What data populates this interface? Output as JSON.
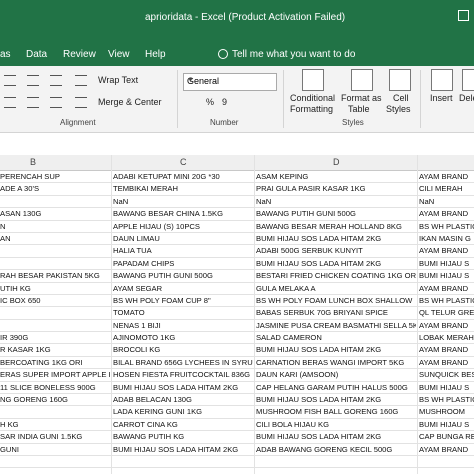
{
  "window": {
    "title": "aprioridata  -  Excel (Product Activation Failed)"
  },
  "menu": {
    "items": [
      "as",
      "Data",
      "Review",
      "View",
      "Help"
    ],
    "tell_me": "Tell me what you want to do"
  },
  "ribbon": {
    "wrap_text": "Wrap Text",
    "merge_center": "Merge & Center",
    "number_format": "General",
    "conditional_formatting": [
      "Conditional",
      "Formatting"
    ],
    "format_as_table": [
      "Format as",
      "Table"
    ],
    "cell_styles": [
      "Cell",
      "Styles"
    ],
    "insert": "Insert",
    "delete": "Delete",
    "group_alignment": "Alignment",
    "group_number": "Number",
    "group_styles": "Styles",
    "number_symbols": [
      "%",
      "9"
    ]
  },
  "columns": [
    "B",
    "C",
    "D"
  ],
  "rows": [
    [
      "PERENCAH SUP",
      "ADABI KETUPAT MINI 20G *30",
      "ASAM KEPING",
      "AYAM BRAND"
    ],
    [
      "ADE A 30'S",
      "TEMBIKAI MERAH",
      "PRAI GULA PASIR KASAR 1KG",
      "CILI MERAH"
    ],
    [
      "",
      "NaN",
      "NaN",
      "NaN"
    ],
    [
      "ASAN 130G",
      "BAWANG BESAR CHINA 1.5KG",
      "BAWANG PUTIH GUNI 500G",
      "AYAM BRAND"
    ],
    [
      "N",
      "APPLE HIJAU (S) 10PCS",
      "BAWANG BESAR MERAH HOLLAND 8KG",
      "BS WH PLASTIC"
    ],
    [
      "AN",
      "DAUN LIMAU",
      "BUMI HIJAU SOS LADA HITAM 2KG",
      "IKAN MASIN G"
    ],
    [
      "",
      "HALIA TUA",
      "ADABI 500G SERBUK KUNYIT",
      "AYAM BRAND"
    ],
    [
      "",
      "PAPADAM CHIPS",
      "BUMI HIJAU SOS LADA HITAM 2KG",
      "BUMI HIJAU S"
    ],
    [
      "RAH BESAR PAKISTAN 5KG",
      "BAWANG PUTIH GUNI 500G",
      "BESTARI FRIED CHICKEN COATING 1KG ORI",
      "BUMI HIJAU S"
    ],
    [
      "UTIH KG",
      "AYAM SEGAR",
      "GULA MELAKA A",
      "AYAM BRAND"
    ],
    [
      "IC BOX 650",
      "BS WH POLY FOAM CUP 8\"",
      "BS WH POLY FOAM LUNCH BOX SHALLOW",
      "BS WH PLASTIC"
    ],
    [
      "",
      "TOMATO",
      "BABAS SERBUK 70G BRIYANI SPICE",
      "QL TELUR GRE"
    ],
    [
      "",
      "NENAS 1 BIJI",
      "JASMINE PUSA CREAM BASMATHI SELLA 5KG",
      "AYAM BRAND"
    ],
    [
      "IR 390G",
      "AJINOMOTO 1KG",
      "SALAD CAMERON",
      "LOBAK MERAH"
    ],
    [
      "R KASAR 1KG",
      "BROCOLI KG",
      "BUMI HIJAU SOS LADA HITAM 2KG",
      "AYAM BRAND"
    ],
    [
      "BERCOATING 1KG ORI",
      "BILAL BRAND 656G LYCHEES IN SYRUP",
      "CARNATION BERAS WANGI IMPORT 5KG",
      "AYAM BRAND"
    ],
    [
      "ERAS SUPER IMPORT APPLE H",
      "HOSEN FIESTA FRUITCOCKTAIL 836G",
      "DAUN KARI (AMSOON)",
      "SUNQUICK BES"
    ],
    [
      "11 SLICE BONELESS 900G",
      "BUMI HIJAU SOS LADA HITAM 2KG",
      "CAP HELANG GARAM PUTIH HALUS 500G",
      "BUMI HIJAU S"
    ],
    [
      "NG GORENG 160G",
      "ADAB BELACAN 130G",
      "BUMI HIJAU SOS LADA HITAM 2KG",
      "BS WH PLASTIC"
    ],
    [
      "",
      "LADA KERING GUNI 1KG",
      "MUSHROOM FISH BALL GORENG 160G",
      "MUSHROOM"
    ],
    [
      "H KG",
      "CARROT CINA KG",
      "CILI BOLA HIJAU KG",
      "BUMI HIJAU S"
    ],
    [
      "SAR INDIA GUNI 1.5KG",
      "BAWANG PUTIH KG",
      "BUMI HIJAU SOS LADA HITAM 2KG",
      "CAP BUNGA RE"
    ],
    [
      "GUNI",
      "BUMI HIJAU SOS LADA HITAM 2KG",
      "ADAB BAWANG GORENG KECIL 500G",
      "AYAM BRAND"
    ],
    [
      "",
      "",
      "",
      ""
    ]
  ]
}
